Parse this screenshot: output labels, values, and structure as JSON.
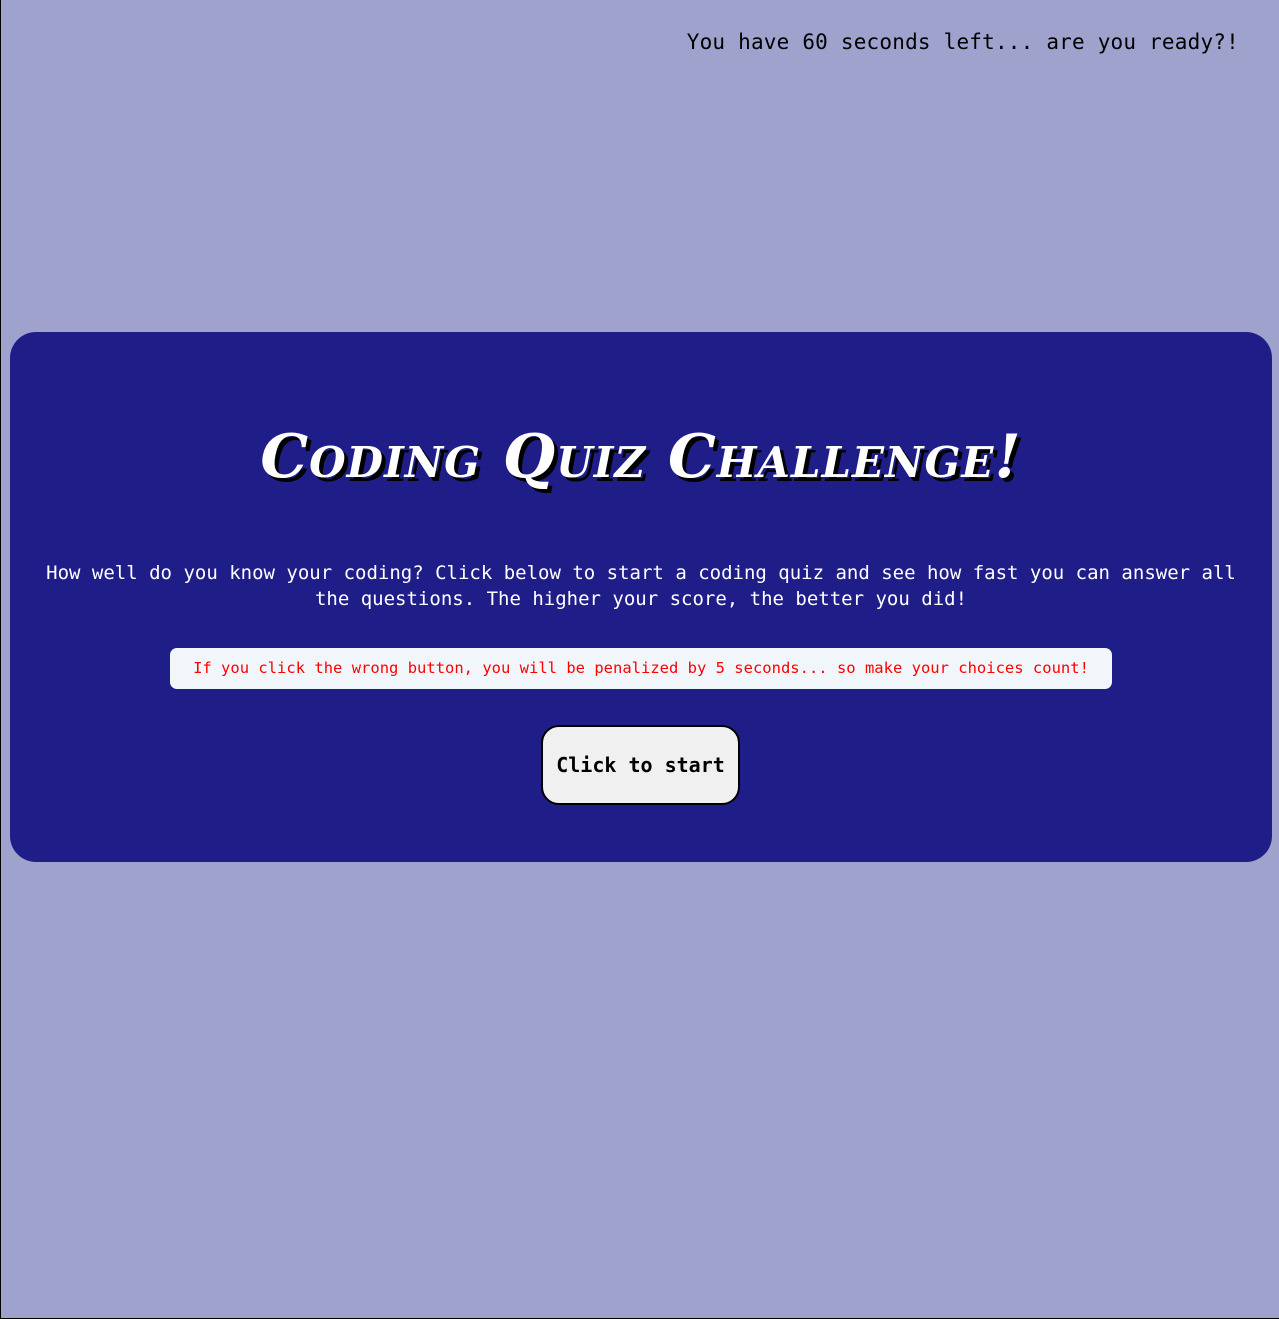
{
  "header": {
    "timer_text": "You have 60 seconds left... are you ready?!"
  },
  "quiz_card": {
    "title": "Coding Quiz Challenge!",
    "intro": "How well do you know your coding? Click below to start a coding quiz and see how fast you can answer all the questions. The higher your score, the better you did!",
    "warning": "If you click the wrong button, you will be penalized by 5 seconds... so make your choices count!",
    "start_button_label": "Click to start"
  },
  "colors": {
    "page_background": "#a0a2ce",
    "card_background": "#1f1e89",
    "warning_text": "#ff0000",
    "warning_background": "#f1f6fb",
    "button_background": "#f0f0f0"
  }
}
